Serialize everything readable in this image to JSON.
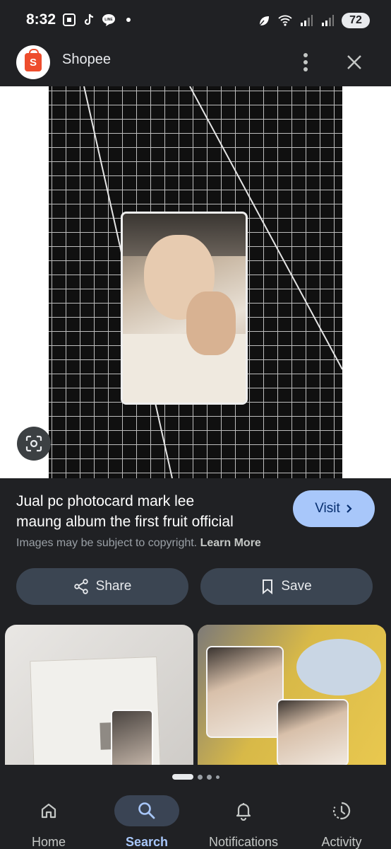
{
  "status_bar": {
    "time": "8:32",
    "battery": "72",
    "icons_left": [
      "screenshot-icon",
      "tiktok-icon",
      "line-icon",
      "dot-icon"
    ],
    "icons_right": [
      "leaf-icon",
      "wifi-icon",
      "signal-icon",
      "signal-icon"
    ]
  },
  "source": {
    "name": "Shopee",
    "logo_letter": "S",
    "brand_color": "#ee4d2d"
  },
  "result": {
    "title_line1": "Jual pc photocard mark lee",
    "title_line2": "maung album the first fruit official",
    "visit_label": "Visit",
    "copyright_text": "Images may be subject to copyright.",
    "learn_more_label": "Learn More",
    "share_label": "Share",
    "save_label": "Save"
  },
  "carousel": {
    "pages": 4,
    "active_page": 1
  },
  "bottom_nav": {
    "items": [
      {
        "label": "Home",
        "icon": "home-icon"
      },
      {
        "label": "Search",
        "icon": "search-icon",
        "active": true
      },
      {
        "label": "Notifications",
        "icon": "bell-icon"
      },
      {
        "label": "Activity",
        "icon": "activity-icon"
      }
    ]
  },
  "colors": {
    "background": "#202124",
    "accent": "#a8c7fa",
    "button_bg": "#3b4552"
  }
}
